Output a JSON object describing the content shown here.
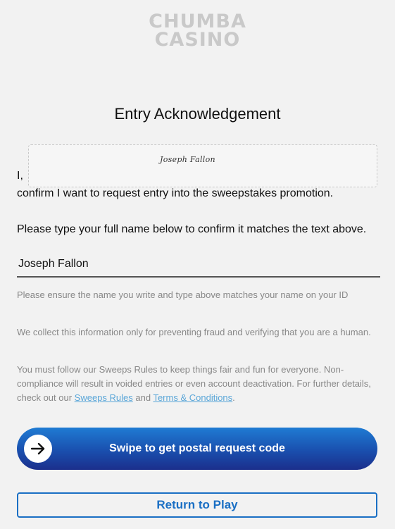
{
  "logo": {
    "line1": "CHUMBA",
    "line2": "CASINO"
  },
  "title": "Entry Acknowledgement",
  "signature": {
    "text": "Joseph Fallon"
  },
  "ack": {
    "prefix": "I,",
    "confirm_text": "confirm I want to request entry into the sweepstakes promotion."
  },
  "name_prompt": "Please type your full name below to confirm it matches the text above.",
  "name_input": {
    "value": "Joseph Fallon"
  },
  "hint": "Please ensure the name you write and type above matches your name on your ID",
  "info_text": "We collect this information only for preventing fraud and verifying that you are a human.",
  "rules": {
    "text_before": "You must follow our Sweeps Rules to keep things fair and fun for everyone. Non-compliance will result in voided entries or even account deactivation. For further details, check out our ",
    "sweeps_rules_link": "Sweeps Rules",
    "and_text": " and ",
    "terms_link": "Terms & Conditions",
    "end_text": "."
  },
  "swipe_button": {
    "label": "Swipe to get postal request code",
    "icon": "arrow-right-icon"
  },
  "return_button": {
    "label": "Return to Play"
  },
  "colors": {
    "accent": "#1a6fc4",
    "link": "#5aa6d8",
    "background": "#f2f2f2"
  }
}
